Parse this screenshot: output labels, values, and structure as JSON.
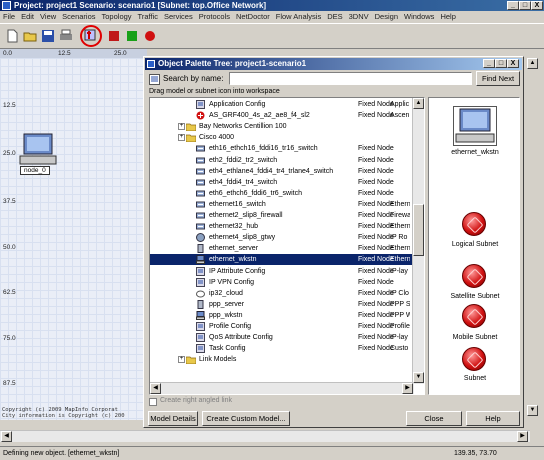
{
  "app": {
    "title": "Project: project1 Scenario: scenario1  [Subnet: top.Office Network]",
    "window_buttons": [
      "_",
      "□",
      "X"
    ],
    "menu": [
      "File",
      "Edit",
      "View",
      "Scenarios",
      "Topology",
      "Traffic",
      "Services",
      "Protocols",
      "NetDoctor",
      "Flow Analysis",
      "DES",
      "3DNV",
      "Design",
      "Windows",
      "Help"
    ]
  },
  "workspace": {
    "ruler_top": [
      "0.0",
      "12.5",
      "25.0"
    ],
    "ruler_left": [
      "12.5",
      "25.0",
      "37.5",
      "50.0",
      "62.5",
      "75.0",
      "87.5"
    ],
    "node_label": "node_0",
    "copyright_1": "Copyright (c) 2009 MapInfo Corporat",
    "copyright_2": "City information is Copyright (c) 200"
  },
  "status": {
    "message": "Defining new object. [ethernet_wkstn]",
    "coords": "139.35, 73.70"
  },
  "dialog": {
    "title": "Object Palette Tree: project1-scenario1",
    "window_buttons": [
      "_",
      "□",
      "X"
    ],
    "search_label": "Search by name:",
    "search_value": "",
    "find_next": "Find Next",
    "instruction": "Drag model or subnet icon into workspace",
    "checkbox_label": "Create right angled link",
    "buttons": {
      "model_details": "Model Details",
      "create_custom": "Create Custom Model...",
      "close": "Close",
      "help": "Help"
    },
    "tree": [
      {
        "name": "Application Config",
        "type": "Fixed Node",
        "desc": "Applic",
        "icon": "config",
        "indent": 1
      },
      {
        "name": "AS_GRF400_4s_a2_ae8_f4_sl2",
        "type": "Fixed Node",
        "desc": "Ascen",
        "icon": "router-red",
        "indent": 1
      },
      {
        "name": "Bay Networks Centillion 100",
        "type": "",
        "desc": "",
        "icon": "folder",
        "indent": 0
      },
      {
        "name": "Cisco 4000",
        "type": "",
        "desc": "",
        "icon": "folder",
        "indent": 0
      },
      {
        "name": "eth16_ethch16_fddi16_tr16_switch",
        "type": "Fixed Node",
        "desc": "",
        "icon": "switch",
        "indent": 1
      },
      {
        "name": "eth2_fddi2_tr2_switch",
        "type": "Fixed Node",
        "desc": "",
        "icon": "switch",
        "indent": 1
      },
      {
        "name": "eth4_ethlane4_fddi4_tr4_trlane4_switch",
        "type": "Fixed Node",
        "desc": "",
        "icon": "switch",
        "indent": 1
      },
      {
        "name": "eth4_fddi4_tr4_switch",
        "type": "Fixed Node",
        "desc": "",
        "icon": "switch",
        "indent": 1
      },
      {
        "name": "eth6_ethch6_fddi6_tr6_switch",
        "type": "Fixed Node",
        "desc": "",
        "icon": "switch",
        "indent": 1
      },
      {
        "name": "ethernet16_switch",
        "type": "Fixed Node",
        "desc": "Ethern",
        "icon": "switch",
        "indent": 1
      },
      {
        "name": "ethernet2_slip8_firewall",
        "type": "Fixed Node",
        "desc": "Firewa",
        "icon": "switch",
        "indent": 1
      },
      {
        "name": "ethernet32_hub",
        "type": "Fixed Node",
        "desc": "Ethern",
        "icon": "switch",
        "indent": 1
      },
      {
        "name": "ethernet4_slip8_gtwy",
        "type": "Fixed Node",
        "desc": "IP Ro",
        "icon": "gateway",
        "indent": 1
      },
      {
        "name": "ethernet_server",
        "type": "Fixed Node",
        "desc": "Ethern",
        "icon": "server",
        "indent": 1
      },
      {
        "name": "ethernet_wkstn",
        "type": "Fixed Node",
        "desc": "Ethern",
        "icon": "wkstn",
        "indent": 1,
        "selected": true
      },
      {
        "name": "IP Attribute Config",
        "type": "Fixed Node",
        "desc": "IP-lay",
        "icon": "config",
        "indent": 1
      },
      {
        "name": "IP VPN Config",
        "type": "Fixed Node",
        "desc": "",
        "icon": "config",
        "indent": 1
      },
      {
        "name": "ip32_cloud",
        "type": "Fixed Node",
        "desc": "IP Clo",
        "icon": "cloud",
        "indent": 1
      },
      {
        "name": "ppp_server",
        "type": "Fixed Node",
        "desc": "PPP S",
        "icon": "server",
        "indent": 1
      },
      {
        "name": "ppp_wkstn",
        "type": "Fixed Node",
        "desc": "PPP W",
        "icon": "wkstn",
        "indent": 1
      },
      {
        "name": "Profile Config",
        "type": "Fixed Node",
        "desc": "Profile",
        "icon": "config",
        "indent": 1
      },
      {
        "name": "QoS Attribute Config",
        "type": "Fixed Node",
        "desc": "IP-lay",
        "icon": "config",
        "indent": 1
      },
      {
        "name": "Task Config",
        "type": "Fixed Node",
        "desc": "Custo",
        "icon": "config",
        "indent": 1
      },
      {
        "name": "Link Models",
        "type": "",
        "desc": "",
        "icon": "folder",
        "indent": 0
      }
    ],
    "preview": {
      "selected_label": "ethernet_wkstn",
      "items": [
        "Logical Subnet",
        "Satellite Subnet",
        "Mobile Subnet",
        "Subnet"
      ]
    }
  }
}
